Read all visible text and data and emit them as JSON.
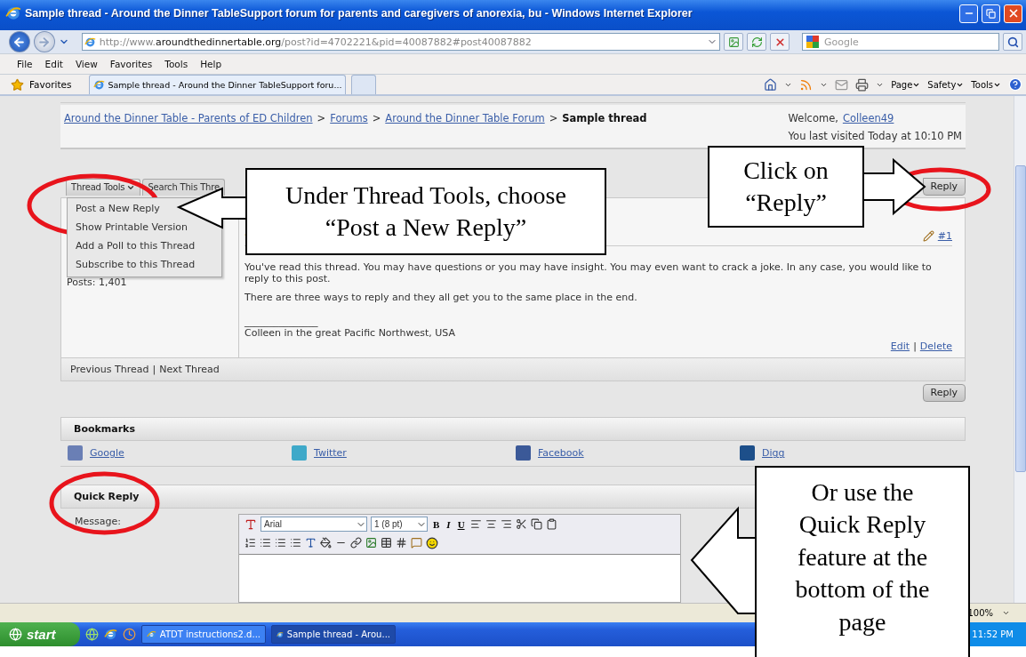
{
  "window": {
    "title": "Sample thread - Around the Dinner TableSupport forum for parents and caregivers of anorexia, bu - Windows Internet Explorer"
  },
  "address_bar": {
    "url_parts": [
      {
        "text": "http://www.",
        "emphasis": false
      },
      {
        "text": "aroundthedinnertable.org",
        "emphasis": true
      },
      {
        "text": "/post?id=4702221&pid=40087882#post40087882",
        "emphasis": false
      }
    ]
  },
  "search": {
    "placeholder": "Google"
  },
  "menu": [
    "File",
    "Edit",
    "View",
    "Favorites",
    "Tools",
    "Help"
  ],
  "favorites_label": "Favorites",
  "browser_tabs": [
    {
      "label": "Sample thread - Around the Dinner TableSupport foru...",
      "selected": true
    }
  ],
  "command_bar": [
    "Page",
    "Safety",
    "Tools"
  ],
  "breadcrumb": {
    "separator": ">",
    "items": [
      {
        "label": "Around the Dinner Table - Parents of ED Children",
        "kind": "link"
      },
      {
        "label": "Forums",
        "kind": "link"
      },
      {
        "label": "Around the Dinner Table Forum",
        "kind": "link"
      },
      {
        "label": "Sample thread",
        "kind": "current"
      }
    ]
  },
  "welcome": {
    "label": "Welcome,",
    "user": "Colleen49",
    "last_visited": "You last visited Today at 10:10 PM"
  },
  "thread_tabs": [
    {
      "label": "Thread Tools",
      "expanded": true
    },
    {
      "label": "Search This Thre",
      "expanded": false
    }
  ],
  "reply_buttons": [
    "Reply",
    "Reply"
  ],
  "thread_tools_menu": [
    "Post a New Reply",
    "Show Printable Version",
    "Add a Poll to this Thread",
    "Subscribe to this Thread"
  ],
  "post": {
    "author_posts": "Posts: 1,401",
    "number": "#1",
    "paragraphs": [
      "You've read this thread.  You may have questions or you may have insight.  You may even want to crack a joke.  In any case, you would like to reply to this post.",
      "There are three ways to reply and they all get you to the same place in the end."
    ],
    "signature_rule": "_______________",
    "signature": "Colleen in the great Pacific Northwest, USA",
    "actions": [
      "Edit",
      "Delete"
    ],
    "action_separator": "|"
  },
  "thread_nav": {
    "items": [
      "Previous Thread",
      "Next Thread"
    ],
    "separator": "|"
  },
  "bookmarks": {
    "title": "Bookmarks",
    "items": [
      {
        "label": "Google",
        "color": "#6a7fb5"
      },
      {
        "label": "Twitter",
        "color": "#3fa9c9"
      },
      {
        "label": "Facebook",
        "color": "#3b5998"
      },
      {
        "label": "Digg",
        "color": "#1d4f8a"
      }
    ]
  },
  "quick_reply": {
    "title": "Quick Reply",
    "message_label": "Message:",
    "font": "Arial",
    "size": "1 (8 pt)",
    "format_buttons": [
      "B",
      "I",
      "U"
    ]
  },
  "status_bar": {
    "zoom": "100%"
  },
  "taskbar": {
    "start": "start",
    "items": [
      {
        "label": "ATDT instructions2.d...",
        "selected": false
      },
      {
        "label": "Sample thread - Arou...",
        "selected": true
      }
    ],
    "clock": "11:52 PM"
  },
  "callouts": [
    {
      "text": "Under Thread Tools, choose “Post a New Reply”"
    },
    {
      "text": "Click on “Reply”"
    },
    {
      "text": "Or use the Quick Reply feature at the bottom of the page"
    }
  ]
}
